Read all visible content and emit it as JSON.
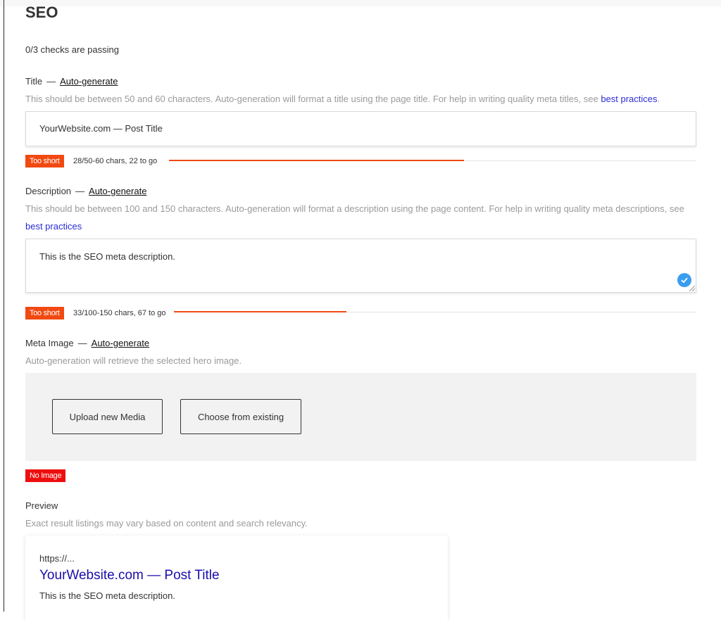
{
  "section": {
    "heading": "SEO",
    "status": "0/3 checks are passing"
  },
  "title_field": {
    "label": "Title",
    "dash": "—",
    "auto_generate": "Auto-generate",
    "help": "This should be between 50 and 60 characters. Auto-generation will format a title using the page title. For help in writing quality meta titles, see",
    "help_link": "best practices",
    "help_suffix": ".",
    "value": "YourWebsite.com — Post Title",
    "badge": "Too short",
    "meter_text": "28/50-60 chars, 22 to go",
    "progress": 0.56
  },
  "description_field": {
    "label": "Description",
    "dash": "—",
    "auto_generate": "Auto-generate",
    "help": "This should be between 100 and 150 characters. Auto-generation will format a description using the page content. For help in writing quality meta descriptions, see",
    "help_link": "best practices",
    "value": "This is the SEO meta description.",
    "badge": "Too short",
    "meter_text": "33/100-150 chars, 67 to go",
    "progress": 0.33
  },
  "meta_image": {
    "label": "Meta Image",
    "dash": "—",
    "auto_generate": "Auto-generate",
    "help": "Auto-generation will retrieve the selected hero image.",
    "upload_button": "Upload new Media",
    "choose_button": "Choose from existing",
    "badge": "No Image"
  },
  "preview": {
    "label": "Preview",
    "help": "Exact result listings may vary based on content and search relevancy.",
    "url": "https://...",
    "title": "YourWebsite.com — Post Title",
    "description": "This is the SEO meta description."
  },
  "colors": {
    "warning": "#f04a12",
    "error": "#ee0e0e",
    "link": "#2b2bd6",
    "preview_title": "#1a0dab",
    "check": "#3a9df0"
  },
  "icons": {
    "description_valid": "check-circle-icon"
  }
}
